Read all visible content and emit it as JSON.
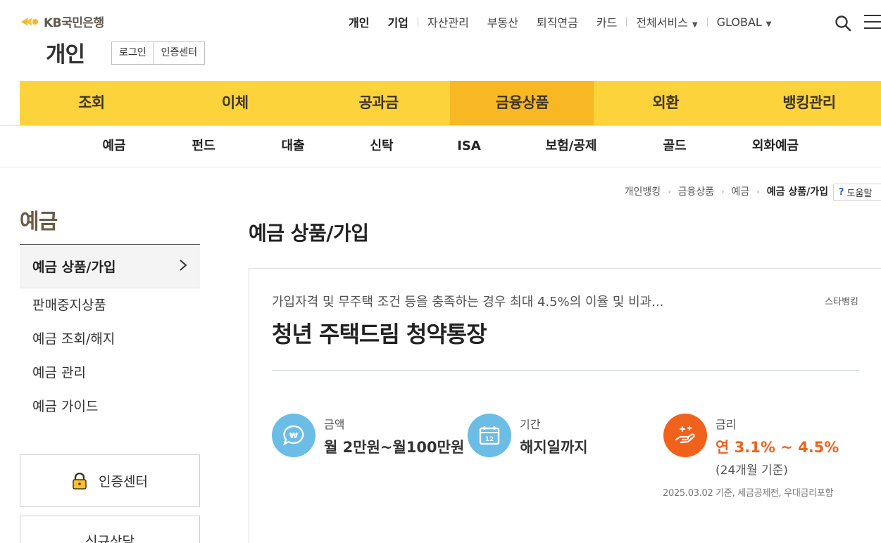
{
  "header": {
    "logo_text": "KB국민은행",
    "section": "개인",
    "auth": {
      "login": "로그인",
      "cert": "인증센터"
    },
    "top_nav": {
      "personal": "개인",
      "business": "기업",
      "asset": "자산관리",
      "realestate": "부동산",
      "pension": "퇴직연금",
      "card": "카드",
      "all": "전체서비스",
      "global": "GLOBAL"
    }
  },
  "gnb": [
    "조회",
    "이체",
    "공과금",
    "금융상품",
    "외환",
    "뱅킹관리"
  ],
  "subnav": [
    "예금",
    "펀드",
    "대출",
    "신탁",
    "ISA",
    "보험/공제",
    "골드",
    "외화예금"
  ],
  "breadcrumb": [
    "개인뱅킹",
    "금융상품",
    "예금",
    "예금 상품/가입"
  ],
  "help": "도움말",
  "lnb": {
    "title": "예금",
    "active": "예금 상품/가입",
    "items": [
      "판매중지상품",
      "예금 조회/해지",
      "예금 관리",
      "예금 가이드"
    ],
    "cert_center": "인증센터",
    "consult": "신규상담"
  },
  "main": {
    "title": "예금 상품/가입",
    "product": {
      "desc": "가입자격 및 무주택 조건 등을 충족하는 경우 최대 4.5%의 이율 및 비과...",
      "badge": "스타뱅킹",
      "name": "청년 주택드림 청약통장",
      "amount_label": "금액",
      "amount_value": "월 2만원~월100만원",
      "period_label": "기간",
      "period_value": "해지일까지",
      "rate_label": "금리",
      "rate_value": "연 3.1% ~ 4.5%",
      "rate_sub": "(24개월 기준)",
      "note": "2025.03.02 기준, 세금공제전, 우대금리포함"
    }
  },
  "colors": {
    "gnb": "#fdd33b",
    "gnb_active": "#f7b824",
    "rate": "#f0621b",
    "icon_blue": "#6bbde6",
    "icon_orange": "#f0621b"
  }
}
